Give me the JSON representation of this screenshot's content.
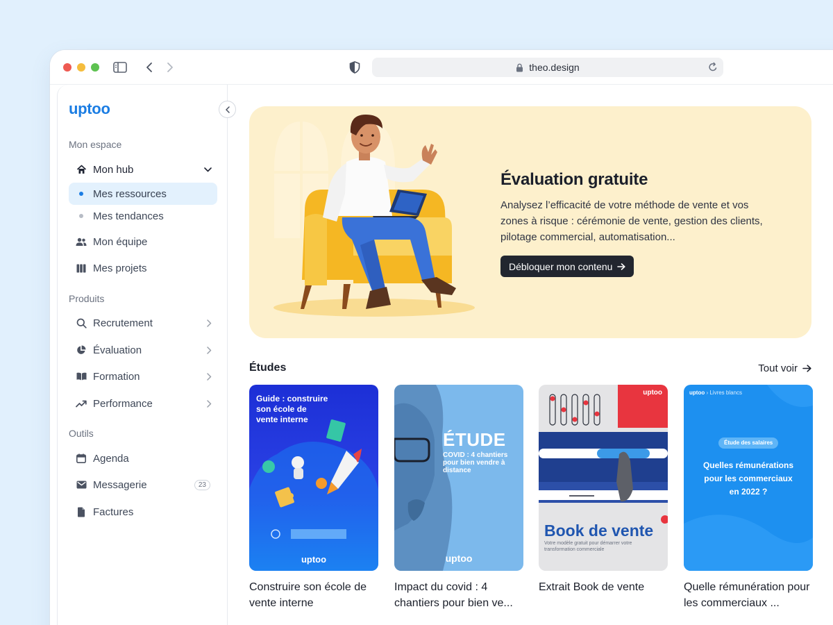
{
  "browser": {
    "url": "theo.design"
  },
  "sidebar": {
    "logo": "uptoo",
    "sections": [
      {
        "label": "Mon espace"
      },
      {
        "label": "Produits"
      },
      {
        "label": "Outils"
      }
    ],
    "hub": {
      "label": "Mon hub",
      "icon": "home-icon"
    },
    "hub_children": [
      {
        "label": "Mes ressources",
        "active": true
      },
      {
        "label": "Mes tendances",
        "active": false
      }
    ],
    "espace_items": [
      {
        "label": "Mon équipe",
        "icon": "team-icon"
      },
      {
        "label": "Mes projets",
        "icon": "columns-icon"
      }
    ],
    "produits_items": [
      {
        "label": "Recrutement",
        "icon": "search-icon"
      },
      {
        "label": "Évaluation",
        "icon": "pie-chart-icon"
      },
      {
        "label": "Formation",
        "icon": "book-icon"
      },
      {
        "label": "Performance",
        "icon": "trend-up-icon"
      }
    ],
    "outils_items": [
      {
        "label": "Agenda",
        "icon": "calendar-icon"
      },
      {
        "label": "Messagerie",
        "icon": "mail-icon",
        "badge": "23"
      },
      {
        "label": "Factures",
        "icon": "file-icon"
      }
    ]
  },
  "hero": {
    "title": "Évaluation gratuite",
    "description": "Analysez l’efficacité de votre méthode de vente et vos zones à risque : cérémonie de vente, gestion des clients, pilotage commercial, automatisation...",
    "button": "Débloquer mon contenu"
  },
  "studies": {
    "title": "Études",
    "see_all": "Tout voir",
    "cards": [
      {
        "title": "Construire son école de vente interne",
        "thumb_lines": [
          "Guide : construire",
          "son école de",
          "vente interne"
        ],
        "thumb_brand": "uptoo"
      },
      {
        "title": "Impact du covid : 4 chantiers pour bien ve...",
        "thumb_heading": "ÉTUDE",
        "thumb_lines": [
          "COVID : 4 chantiers",
          "pour bien vendre à",
          "distance"
        ],
        "thumb_brand": "uptoo"
      },
      {
        "title": "Extrait Book de vente",
        "thumb_heading": "Book de vente",
        "thumb_sub": "Votre modèle gratuit pour démarrer votre transformation commerciale",
        "thumb_brand": "uptoo"
      },
      {
        "title": "Quelle rémunération pour les commerciaux ...",
        "thumb_tag": "Étude des salaires",
        "thumb_lines": [
          "Quelles rémunérations",
          "pour les commerciaux",
          "en 2022 ?"
        ],
        "thumb_brand": "uptoo",
        "thumb_crumb": "Livres blancs"
      }
    ]
  },
  "colors": {
    "brand": "#1b7de3",
    "hero_bg": "#fdf0cc",
    "active_bg": "#e3f1fd",
    "button_dark": "#22262f"
  }
}
